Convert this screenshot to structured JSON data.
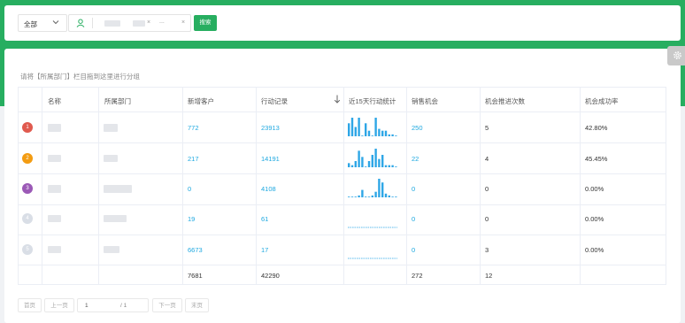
{
  "filters": {
    "scope_select": "全部",
    "more_indicator": "...",
    "search_button": "搜索"
  },
  "settings_icon": "gear-icon",
  "hint_text": "请将【所属部门】栏目拖到这里进行分组",
  "table": {
    "headers": [
      "名称",
      "所属部门",
      "新增客户",
      "行动记录",
      "近15天行动统计",
      "销售机会",
      "机会推进次数",
      "机会成功率"
    ],
    "rows": [
      {
        "rank": "1",
        "rank_color": "#e05a4e",
        "new_customers": "772",
        "actions": "23913",
        "opportunities": "250",
        "advances": "5",
        "success_rate": "42.80%",
        "spark": [
          7,
          10,
          5,
          10,
          0,
          7,
          3,
          0,
          10,
          4,
          3,
          3,
          1,
          1,
          0
        ]
      },
      {
        "rank": "2",
        "rank_color": "#f39c12",
        "new_customers": "217",
        "actions": "14191",
        "opportunities": "22",
        "advances": "4",
        "success_rate": "45.45%",
        "spark": [
          2,
          1,
          3,
          8,
          5,
          0,
          3,
          6,
          9,
          4,
          6,
          1,
          1,
          1,
          0
        ]
      },
      {
        "rank": "3",
        "rank_color": "#9b59b6",
        "new_customers": "0",
        "actions": "4108",
        "opportunities": "0",
        "advances": "0",
        "success_rate": "0.00%",
        "spark": [
          0,
          0,
          0,
          1,
          4,
          0,
          0,
          1,
          3,
          10,
          8,
          2,
          1,
          0,
          0
        ]
      },
      {
        "rank": "4",
        "rank_color": "#d9dee6",
        "new_customers": "19",
        "actions": "61",
        "opportunities": "0",
        "advances": "0",
        "success_rate": "0.00%",
        "spark": [
          0,
          0,
          0,
          0,
          0,
          0,
          0,
          0,
          0,
          0,
          0,
          0,
          0,
          0,
          0
        ]
      },
      {
        "rank": "5",
        "rank_color": "#d9dee6",
        "new_customers": "6673",
        "actions": "17",
        "opportunities": "0",
        "advances": "3",
        "success_rate": "0.00%",
        "spark": [
          0,
          0,
          0,
          0,
          0,
          0,
          0,
          0,
          0,
          0,
          0,
          0,
          0,
          0,
          0
        ]
      }
    ],
    "totals": {
      "new_customers": "7681",
      "actions": "42290",
      "opportunities": "272",
      "advances": "12"
    }
  },
  "pagination": {
    "first": "首页",
    "prev": "上一页",
    "page": "1",
    "total": "/ 1",
    "next": "下一页",
    "last": "末页"
  },
  "colors": {
    "accent": "#27ae60",
    "link": "#1ea8e0",
    "spark": "#2ea6e6"
  }
}
